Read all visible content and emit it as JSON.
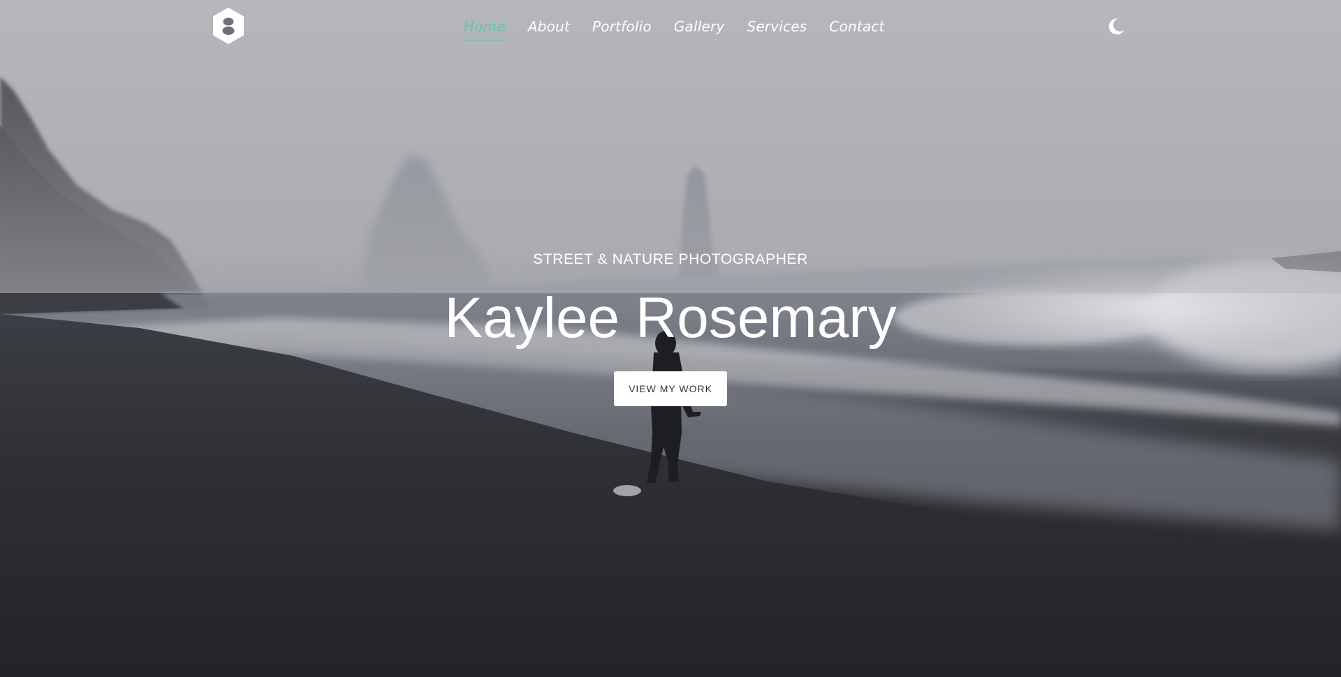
{
  "nav": {
    "items": [
      {
        "label": "Home",
        "active": true
      },
      {
        "label": "About",
        "active": false
      },
      {
        "label": "Portfolio",
        "active": false
      },
      {
        "label": "Gallery",
        "active": false
      },
      {
        "label": "Services",
        "active": false
      },
      {
        "label": "Contact",
        "active": false
      }
    ],
    "logo_icon": "hexagon-logo-icon",
    "theme_toggle_icon": "moon-icon"
  },
  "hero": {
    "subtitle": "STREET & NATURE PHOTOGRAPHER",
    "title": "Kaylee Rosemary",
    "cta_label": "VIEW MY WORK"
  },
  "colors": {
    "accent": "#5ec7b2",
    "text": "#ffffff",
    "button_bg": "#ffffff",
    "button_text": "#333333"
  }
}
